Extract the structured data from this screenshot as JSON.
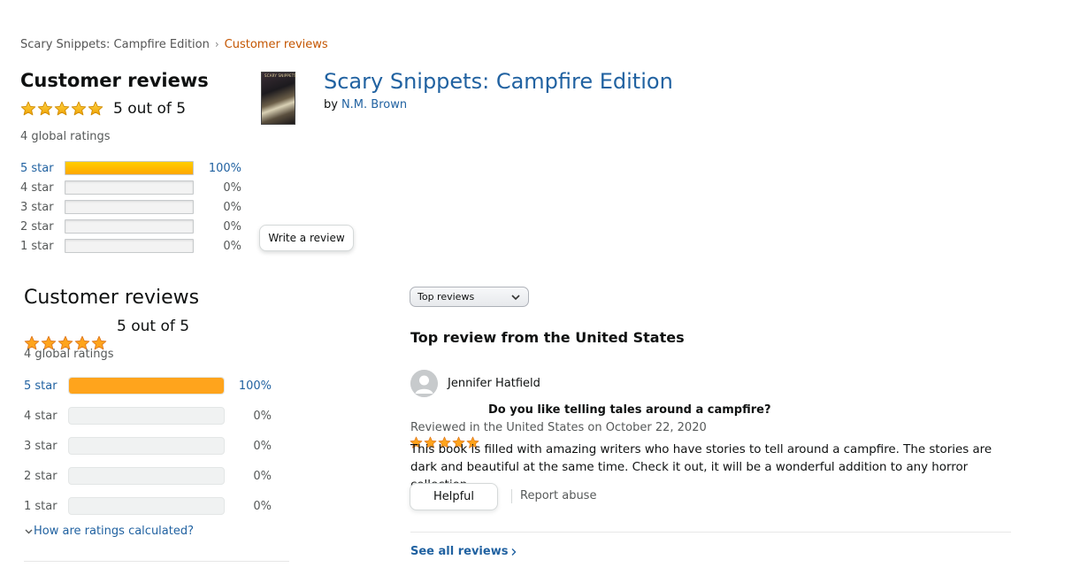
{
  "breadcrumb": {
    "parent": "Scary Snippets: Campfire Edition",
    "current": "Customer reviews"
  },
  "summary_top": {
    "heading": "Customer reviews",
    "rating_value": 5,
    "rating_text": "5 out of 5",
    "global_ratings": "4 global ratings",
    "histogram": [
      {
        "label": "5 star",
        "percent": 100,
        "percent_text": "100%"
      },
      {
        "label": "4 star",
        "percent": 0,
        "percent_text": "0%"
      },
      {
        "label": "3 star",
        "percent": 0,
        "percent_text": "0%"
      },
      {
        "label": "2 star",
        "percent": 0,
        "percent_text": "0%"
      },
      {
        "label": "1 star",
        "percent": 0,
        "percent_text": "0%"
      }
    ],
    "write_review_label": "Write a review"
  },
  "product": {
    "title": "Scary Snippets: Campfire Edition",
    "by_label": "by",
    "author": "N.M. Brown",
    "cover_text": "SCARY SNIPPETS"
  },
  "summary_bottom": {
    "heading": "Customer reviews",
    "rating_value": 5,
    "rating_text": "5 out of 5",
    "global_ratings": "4 global ratings",
    "histogram": [
      {
        "label": "5 star",
        "percent": 100,
        "percent_text": "100%"
      },
      {
        "label": "4 star",
        "percent": 0,
        "percent_text": "0%"
      },
      {
        "label": "3 star",
        "percent": 0,
        "percent_text": "0%"
      },
      {
        "label": "2 star",
        "percent": 0,
        "percent_text": "0%"
      },
      {
        "label": "1 star",
        "percent": 0,
        "percent_text": "0%"
      }
    ],
    "how_calculated_link": "How are ratings calculated?"
  },
  "reviews": {
    "sort_selected": "Top reviews",
    "section_heading": "Top review from the United States",
    "items": [
      {
        "reviewer": "Jennifer Hatfield",
        "rating": 5,
        "title": "Do you like telling tales around a campfire?",
        "date_line": "Reviewed in the United States on October 22, 2020",
        "body": "This book is filled with amazing writers who have stories to tell around a campfire. The stories are dark and beautiful at the same time. Check it out, it will be a wonderful addition to any horror collection.",
        "helpful_label": "Helpful",
        "report_label": "Report abuse"
      }
    ],
    "see_all_label": "See all reviews"
  },
  "colors": {
    "link": "#2162a1",
    "breadcrumb_current": "#c45500",
    "star": "#ffa41c",
    "bar_fill": "#ffa41c"
  },
  "icons": [
    "star-icon",
    "chevron-right-icon",
    "chevron-down-icon",
    "avatar-icon"
  ]
}
